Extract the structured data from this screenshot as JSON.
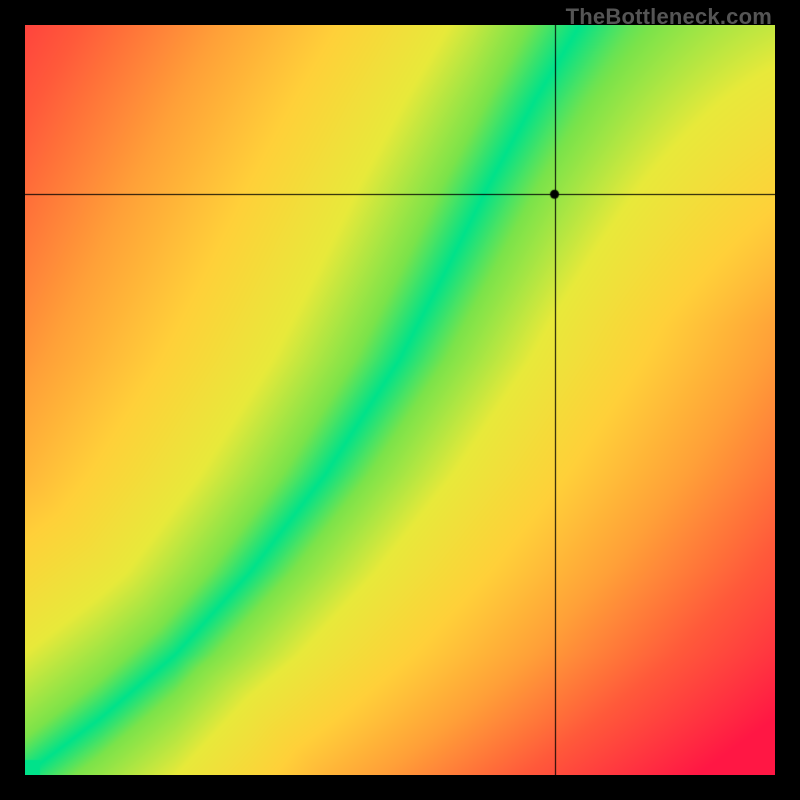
{
  "watermark": "TheBottleneck.com",
  "chart_data": {
    "type": "heatmap",
    "title": "",
    "xlabel": "",
    "ylabel": "",
    "xlim": [
      0,
      1
    ],
    "ylim": [
      0,
      1
    ],
    "crosshair": {
      "x": 0.707,
      "y": 0.774
    },
    "description": "2D rainbow gradient field. A narrow green 'optimal' band runs from the bottom-left corner diagonally to the top edge around x≈0.71, slightly concave. Colors grade from that green ridge outward through yellow to orange to saturated red. The far top-right corner shades toward yellow-green.",
    "ridge_points": [
      {
        "x": 0.0,
        "y": 0.0
      },
      {
        "x": 0.1,
        "y": 0.075
      },
      {
        "x": 0.2,
        "y": 0.16
      },
      {
        "x": 0.3,
        "y": 0.27
      },
      {
        "x": 0.4,
        "y": 0.4
      },
      {
        "x": 0.5,
        "y": 0.555
      },
      {
        "x": 0.56,
        "y": 0.67
      },
      {
        "x": 0.62,
        "y": 0.79
      },
      {
        "x": 0.68,
        "y": 0.9
      },
      {
        "x": 0.74,
        "y": 1.0
      }
    ],
    "color_stops": [
      {
        "t": 0.0,
        "color": "#00e28a"
      },
      {
        "t": 0.1,
        "color": "#7be34a"
      },
      {
        "t": 0.22,
        "color": "#e8e93a"
      },
      {
        "t": 0.38,
        "color": "#ffd039"
      },
      {
        "t": 0.55,
        "color": "#ffa038"
      },
      {
        "t": 0.75,
        "color": "#ff5a3a"
      },
      {
        "t": 1.0,
        "color": "#ff1744"
      }
    ],
    "ridge_halfwidth": 0.055,
    "top_right_pull": 0.4
  }
}
